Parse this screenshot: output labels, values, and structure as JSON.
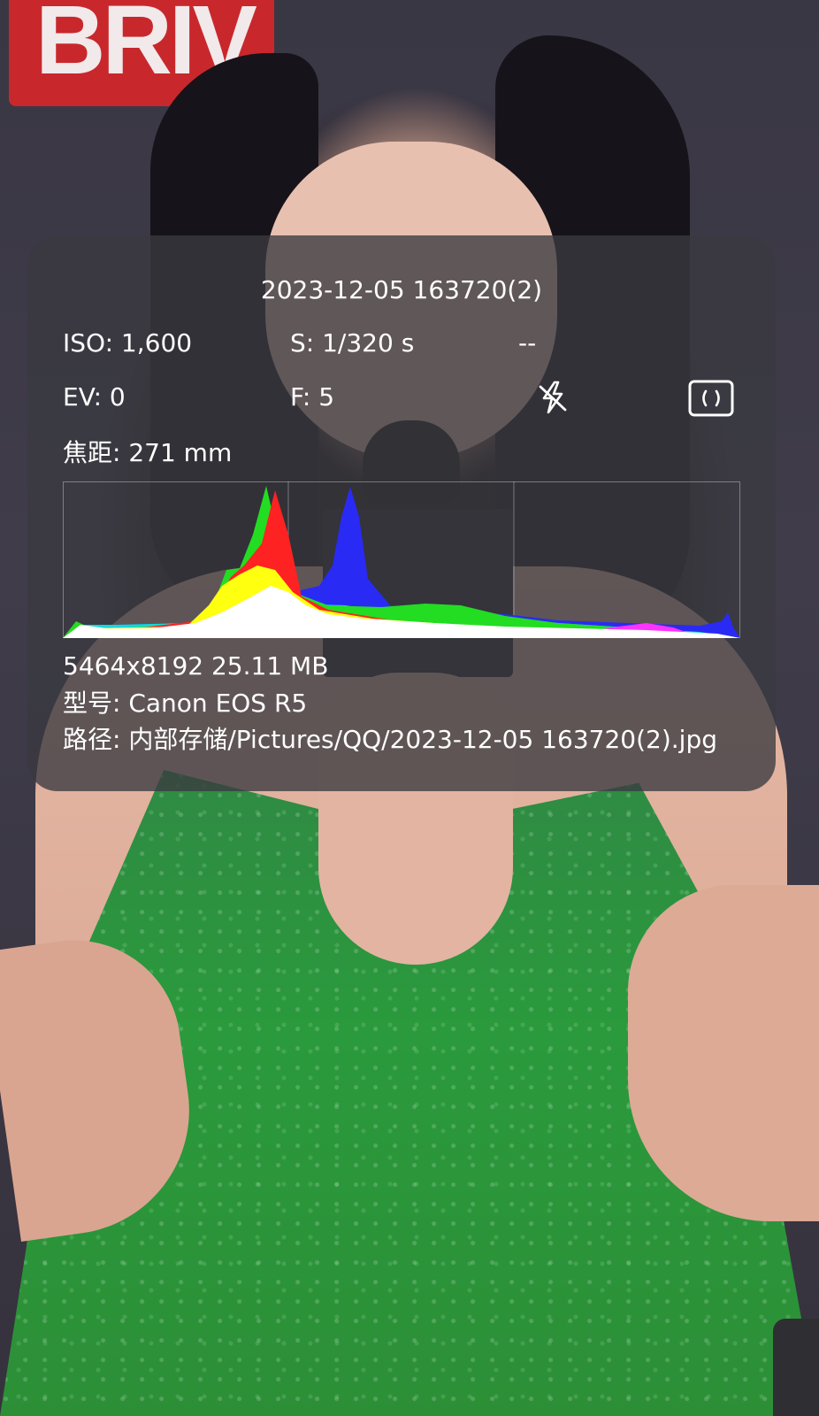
{
  "photo_info": {
    "title": "2023-12-05 163720(2)",
    "iso": "ISO: 1,600",
    "shutter": "S: 1/320 s",
    "extra": "--",
    "ev": "EV: 0",
    "aperture": "F: 5",
    "focal_length": "焦距: 271 mm",
    "dimensions_size": "5464x8192  25.11 MB",
    "model": "型号:  Canon EOS R5",
    "path": "路径:  内部存储/Pictures/QQ/2023-12-05 163720(2).jpg",
    "flash_icon": "flash-off-icon",
    "frame_icon": "metering-frame-icon"
  },
  "background_photo": {
    "brand_text": "BRIV"
  },
  "colors": {
    "panel_bg": "#3a3a40",
    "text": "#ffffff",
    "histogram_red": "#ff2020",
    "histogram_green": "#20e020",
    "histogram_blue": "#2020ff",
    "histogram_yellow": "#ffff00",
    "histogram_cyan": "#00e0e0",
    "histogram_magenta": "#ff30ff",
    "histogram_white": "#ffffff"
  }
}
